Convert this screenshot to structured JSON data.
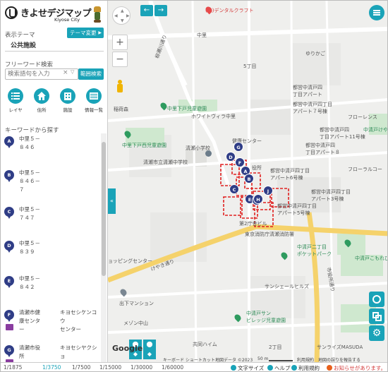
{
  "header": {
    "title": "きよせデジマップ",
    "subtitle": "Kiyose City"
  },
  "theme": {
    "label": "表示テーマ",
    "change_button": "テーマ変更",
    "value": "公共施設"
  },
  "freeword": {
    "label": "フリーワード検索",
    "placeholder": "検索語句を入力",
    "clear_glyph": "×",
    "search_button": "範囲検索"
  },
  "tools": [
    {
      "label": "レイヤ",
      "icon": "layer-list-icon"
    },
    {
      "label": "住所",
      "icon": "house-icon"
    },
    {
      "label": "施設",
      "icon": "building-icon"
    },
    {
      "label": "情報一覧",
      "icon": "info-list-icon"
    }
  ],
  "keyword": {
    "label": "キーワードから探す"
  },
  "list": [
    {
      "marker": "A",
      "text": "中里５－\n８４６"
    },
    {
      "marker": "B",
      "text": "中里５－\n８４６－\n７"
    },
    {
      "marker": "C",
      "text": "中里５－\n７４７"
    },
    {
      "marker": "D",
      "text": "中里５－\n８３９"
    },
    {
      "marker": "E",
      "text": "中里５－\n８４２"
    },
    {
      "marker": "F",
      "text": "清瀬市健\n康センタ\nー",
      "text2": "キヨセシケンコウ\nセンター"
    },
    {
      "marker": "G",
      "text": "清瀬市役\n所",
      "text2": "キヨセシヤクショ"
    }
  ],
  "map": {
    "labels": {
      "dental": "(株)デンタルクラフト",
      "nakazato1": "中里",
      "yurikago": "ゆりかご",
      "chome5": "5丁目",
      "yanagise": "柳瀬川通り",
      "apt7_1": "都営中清戸四\n丁目アパート",
      "apt7_2": "都営中清戸四丁目\nアパート７号棟",
      "park_shimokiyoto": "中里下戸児童遊園",
      "white_villa": "ホワイトヴィラ中里",
      "inarimori": "稲荷森",
      "florence": "フローレンス",
      "apt11": "都営中清戸四\n丁目アパート11号棟",
      "apt8": "都営中清戸四\n丁目アパート８",
      "nakakiyoto_ke": "中清戸けや",
      "shimokiyoto_park": "中里下戸西児童遊園",
      "kiyose_elem": "清瀬小学校",
      "kenko_center": "健康センター",
      "kiyose_middle": "清瀬市立清瀬中学校",
      "floral": "フローラルコー",
      "yakusho": "役所",
      "apt6": "都営中清戸四丁目\nアパート6号棟",
      "apt5": "都営中清戸四丁目\nアパート5号棟",
      "apt3": "都営中清戸四丁目\nアパート3号棟",
      "dai2": "第2庁舎ビル",
      "fire": "東京消防庁清瀬消防署",
      "nakakiyoto2park": "中清戸二丁目\nポケットパーク",
      "komorebi": "中清戸こもれび児",
      "keyaki": "けやき通り",
      "shopping": "ョッピングセンター",
      "sunshell": "サンシェールヒルズ",
      "shiyakusho_st": "市役所通り",
      "depot": "出下マンション",
      "nakakiyoto_sun": "中清戸サン\nビレッジ児童遊園",
      "chome2": "2丁目",
      "masuda": "サンライズMASUDA",
      "menchu": "メゾン中山",
      "kyodo": "共同ハイム"
    },
    "keyboard_shortcuts": "キーボード ショートカット",
    "map_data": "地図データ ©2023",
    "scale_text": "50 m",
    "terms": "利用規約",
    "report": "地図の誤りを報告する",
    "google": "Google",
    "markers": [
      "A",
      "B",
      "C",
      "D",
      "E",
      "F",
      "G",
      "H",
      "I",
      "J"
    ]
  },
  "footer": {
    "scales": [
      "1/1875",
      "1/3750",
      "1/7500",
      "1/15000",
      "1/30000",
      "1/60000"
    ],
    "active_scale": "1/3750",
    "text_size": "文字サイズ",
    "help": "ヘルプ",
    "terms": "利用規約",
    "notice": "お知らせがあります。"
  },
  "colors": {
    "accent": "#1aa3b8",
    "marker": "#2f3d86",
    "notice": "#d43b3b",
    "road_yellow": "#f5d26b"
  }
}
